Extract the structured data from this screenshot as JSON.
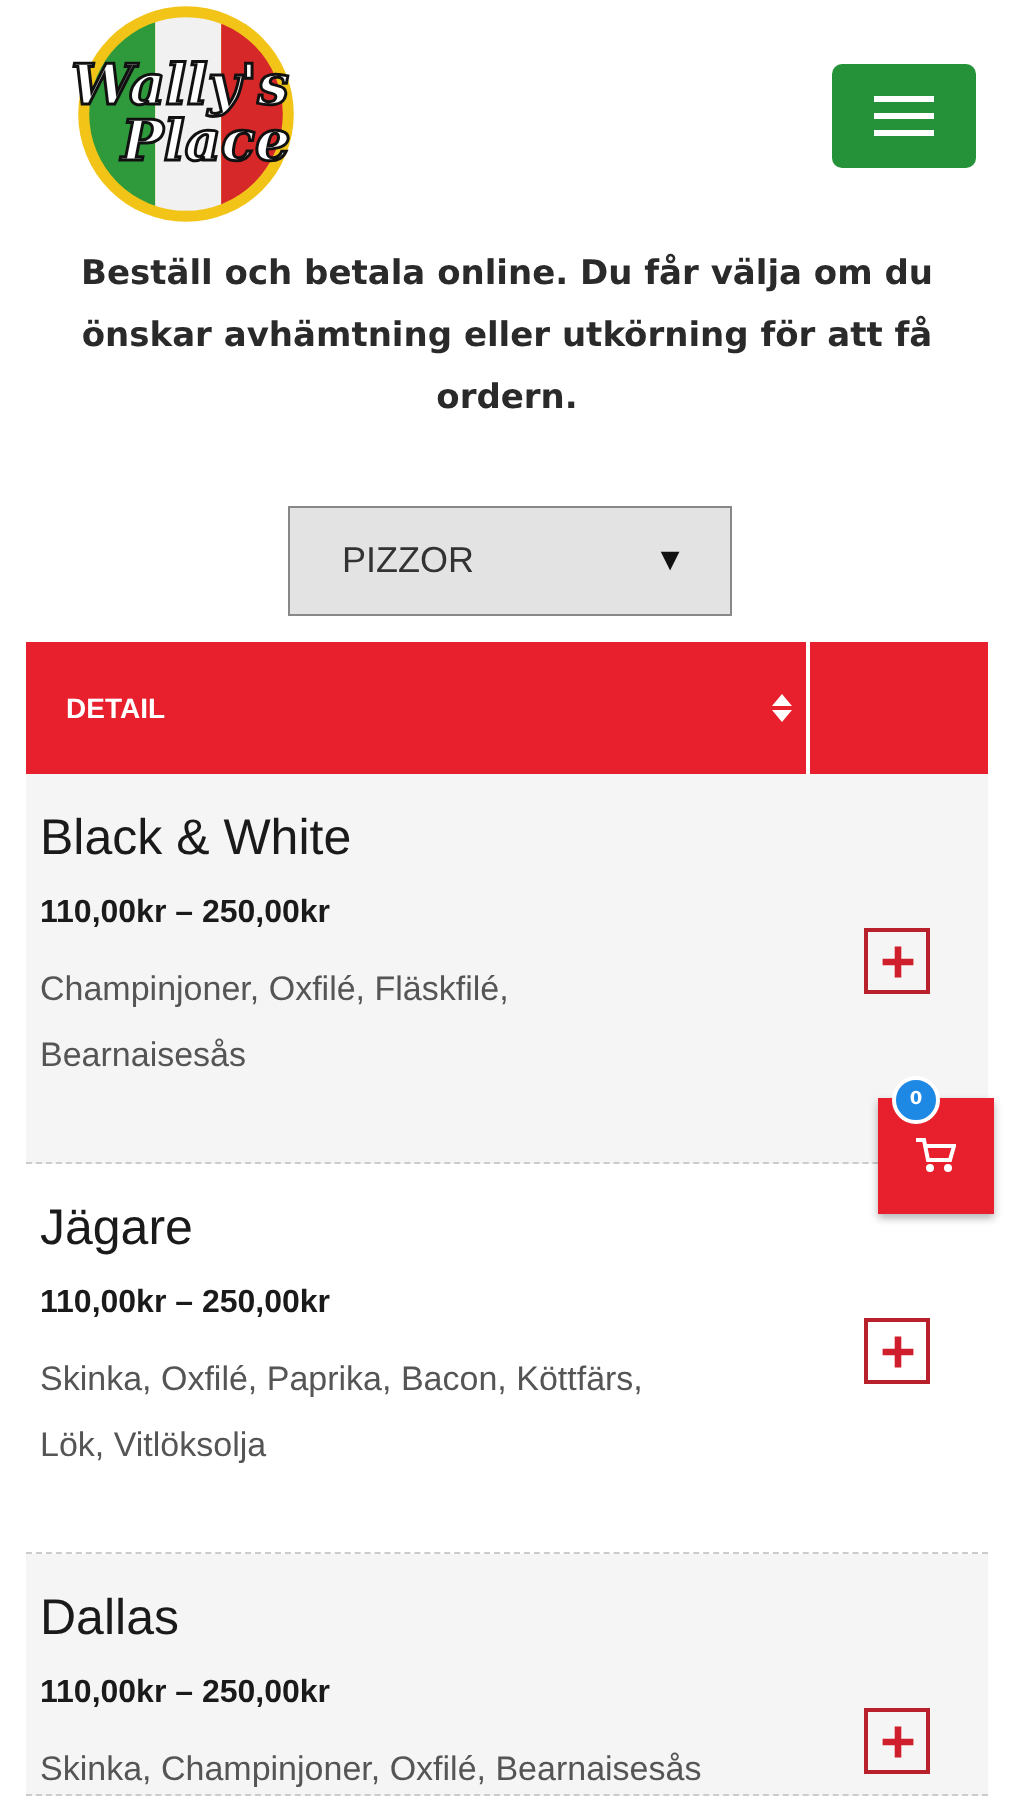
{
  "logo": {
    "line_1": "Wally's",
    "line_2": "Place"
  },
  "intro": "Beställ och betala online. Du får välja om du önskar avhämtning eller utkörning för att få ordern.",
  "category_select": {
    "value": "PIZZOR",
    "arrow": "▼"
  },
  "table": {
    "columns": [
      "DETAIL"
    ],
    "rows": [
      {
        "name": "Black & White",
        "price": "110,00kr – 250,00kr",
        "ingredients": "Champinjoner, Oxfilé, Fläskfilé, Bearnaisesås"
      },
      {
        "name": "Jägare",
        "price": "110,00kr – 250,00kr",
        "ingredients": "Skinka, Oxfilé, Paprika, Bacon, Köttfärs, Lök, Vitlöksolja"
      },
      {
        "name": "Dallas",
        "price": "110,00kr – 250,00kr",
        "ingredients": "Skinka, Champinjoner, Oxfilé, Bearnaisesås"
      }
    ]
  },
  "cart": {
    "count": "0"
  }
}
